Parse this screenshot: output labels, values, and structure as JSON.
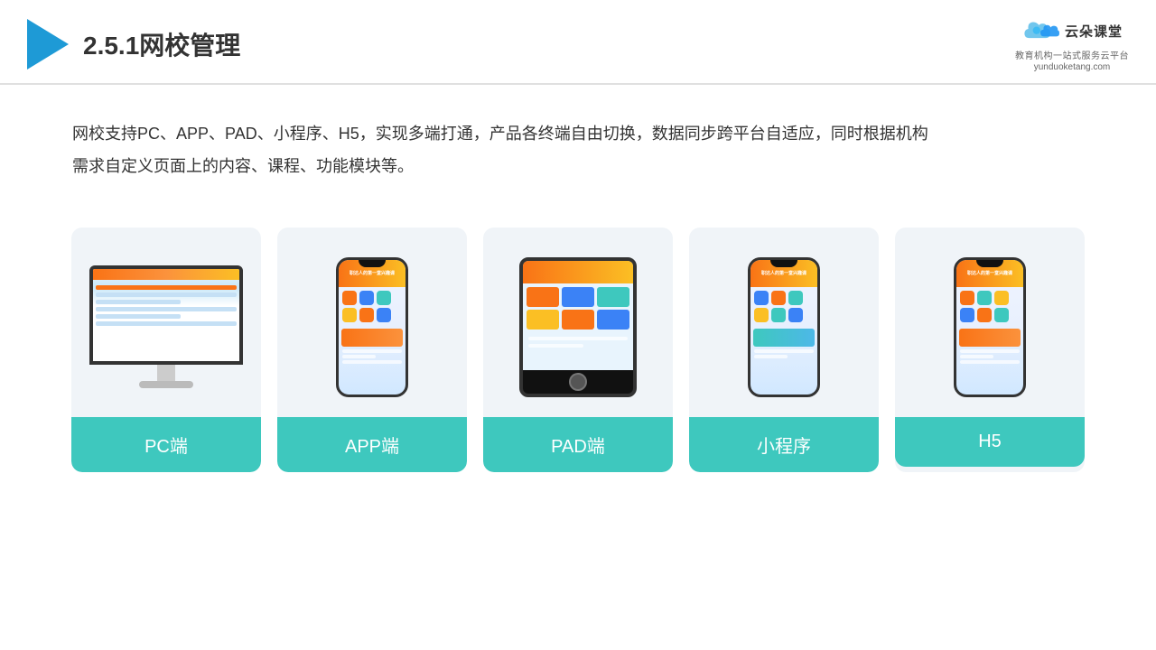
{
  "header": {
    "title": "2.5.1网校管理",
    "brand": {
      "name_cn": "云朵课堂",
      "url": "yunduoketang.com",
      "tagline": "教育机构一站式服务云平台"
    }
  },
  "description": {
    "text": "网校支持PC、APP、PAD、小程序、H5，实现多端打通，产品各终端自由切换，数据同步跨平台自适应，同时根据机构需求自定义页面上的内容、课程、功能模块等。"
  },
  "cards": [
    {
      "id": "pc",
      "label": "PC端"
    },
    {
      "id": "app",
      "label": "APP端"
    },
    {
      "id": "pad",
      "label": "PAD端"
    },
    {
      "id": "miniprogram",
      "label": "小程序"
    },
    {
      "id": "h5",
      "label": "H5"
    }
  ],
  "colors": {
    "teal": "#3ec8be",
    "accent": "#1e9ad6"
  }
}
